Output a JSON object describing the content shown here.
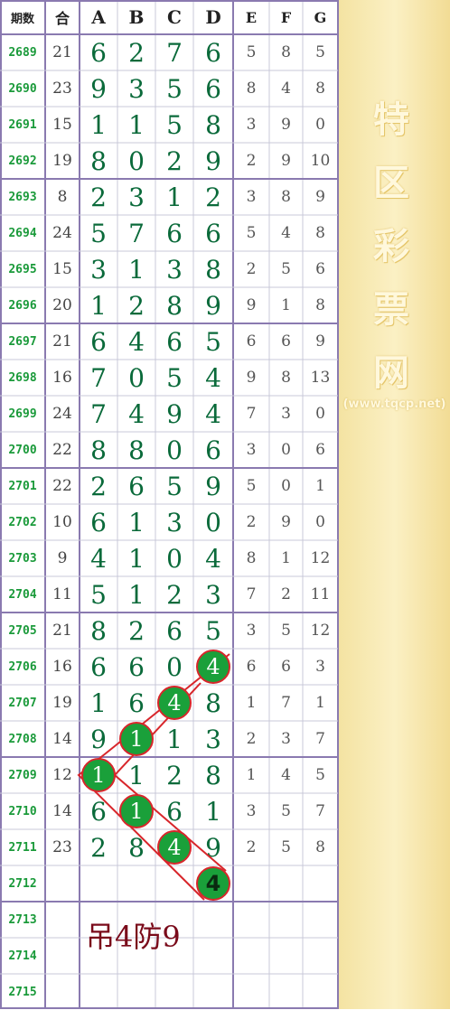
{
  "headers": [
    "期数",
    "合",
    "A",
    "B",
    "C",
    "D",
    "E",
    "F",
    "G"
  ],
  "rows": [
    {
      "issue": "2689",
      "sum": "21",
      "a": "6",
      "b": "2",
      "c": "7",
      "d": "6",
      "e": "5",
      "f": "8",
      "g": "5"
    },
    {
      "issue": "2690",
      "sum": "23",
      "a": "9",
      "b": "3",
      "c": "5",
      "d": "6",
      "e": "8",
      "f": "4",
      "g": "8"
    },
    {
      "issue": "2691",
      "sum": "15",
      "a": "1",
      "b": "1",
      "c": "5",
      "d": "8",
      "e": "3",
      "f": "9",
      "g": "0"
    },
    {
      "issue": "2692",
      "sum": "19",
      "a": "8",
      "b": "0",
      "c": "2",
      "d": "9",
      "e": "2",
      "f": "9",
      "g": "10"
    },
    {
      "issue": "2693",
      "sum": "8",
      "a": "2",
      "b": "3",
      "c": "1",
      "d": "2",
      "e": "3",
      "f": "8",
      "g": "9"
    },
    {
      "issue": "2694",
      "sum": "24",
      "a": "5",
      "b": "7",
      "c": "6",
      "d": "6",
      "e": "5",
      "f": "4",
      "g": "8"
    },
    {
      "issue": "2695",
      "sum": "15",
      "a": "3",
      "b": "1",
      "c": "3",
      "d": "8",
      "e": "2",
      "f": "5",
      "g": "6"
    },
    {
      "issue": "2696",
      "sum": "20",
      "a": "1",
      "b": "2",
      "c": "8",
      "d": "9",
      "e": "9",
      "f": "1",
      "g": "8"
    },
    {
      "issue": "2697",
      "sum": "21",
      "a": "6",
      "b": "4",
      "c": "6",
      "d": "5",
      "e": "6",
      "f": "6",
      "g": "9"
    },
    {
      "issue": "2698",
      "sum": "16",
      "a": "7",
      "b": "0",
      "c": "5",
      "d": "4",
      "e": "9",
      "f": "8",
      "g": "13"
    },
    {
      "issue": "2699",
      "sum": "24",
      "a": "7",
      "b": "4",
      "c": "9",
      "d": "4",
      "e": "7",
      "f": "3",
      "g": "0"
    },
    {
      "issue": "2700",
      "sum": "22",
      "a": "8",
      "b": "8",
      "c": "0",
      "d": "6",
      "e": "3",
      "f": "0",
      "g": "6"
    },
    {
      "issue": "2701",
      "sum": "22",
      "a": "2",
      "b": "6",
      "c": "5",
      "d": "9",
      "e": "5",
      "f": "0",
      "g": "1"
    },
    {
      "issue": "2702",
      "sum": "10",
      "a": "6",
      "b": "1",
      "c": "3",
      "d": "0",
      "e": "2",
      "f": "9",
      "g": "0"
    },
    {
      "issue": "2703",
      "sum": "9",
      "a": "4",
      "b": "1",
      "c": "0",
      "d": "4",
      "e": "8",
      "f": "1",
      "g": "12"
    },
    {
      "issue": "2704",
      "sum": "11",
      "a": "5",
      "b": "1",
      "c": "2",
      "d": "3",
      "e": "7",
      "f": "2",
      "g": "11"
    },
    {
      "issue": "2705",
      "sum": "21",
      "a": "8",
      "b": "2",
      "c": "6",
      "d": "5",
      "e": "3",
      "f": "5",
      "g": "12"
    },
    {
      "issue": "2706",
      "sum": "16",
      "a": "6",
      "b": "6",
      "c": "0",
      "d": "4",
      "e": "6",
      "f": "6",
      "g": "3"
    },
    {
      "issue": "2707",
      "sum": "19",
      "a": "1",
      "b": "6",
      "c": "4",
      "d": "8",
      "e": "1",
      "f": "7",
      "g": "1"
    },
    {
      "issue": "2708",
      "sum": "14",
      "a": "9",
      "b": "1",
      "c": "1",
      "d": "3",
      "e": "2",
      "f": "3",
      "g": "7"
    },
    {
      "issue": "2709",
      "sum": "12",
      "a": "1",
      "b": "1",
      "c": "2",
      "d": "8",
      "e": "1",
      "f": "4",
      "g": "5"
    },
    {
      "issue": "2710",
      "sum": "14",
      "a": "6",
      "b": "1",
      "c": "6",
      "d": "1",
      "e": "3",
      "f": "5",
      "g": "7"
    },
    {
      "issue": "2711",
      "sum": "23",
      "a": "2",
      "b": "8",
      "c": "4",
      "d": "9",
      "e": "2",
      "f": "5",
      "g": "8"
    },
    {
      "issue": "2712",
      "sum": "",
      "a": "",
      "b": "",
      "c": "",
      "d": "4",
      "e": "",
      "f": "",
      "g": ""
    },
    {
      "issue": "2713",
      "sum": "",
      "a": "",
      "b": "",
      "c": "",
      "d": "",
      "e": "",
      "f": "",
      "g": ""
    },
    {
      "issue": "2714",
      "sum": "",
      "a": "",
      "b": "",
      "c": "",
      "d": "",
      "e": "",
      "f": "",
      "g": ""
    },
    {
      "issue": "2715",
      "sum": "",
      "a": "",
      "b": "",
      "c": "",
      "d": "",
      "e": "",
      "f": "",
      "g": ""
    }
  ],
  "highlights": [
    {
      "row": "2706",
      "col": "d",
      "value": "4"
    },
    {
      "row": "2707",
      "col": "c",
      "value": "4"
    },
    {
      "row": "2708",
      "col": "b",
      "value": "1"
    },
    {
      "row": "2709",
      "col": "a",
      "value": "1"
    },
    {
      "row": "2710",
      "col": "b",
      "value": "1"
    },
    {
      "row": "2711",
      "col": "c",
      "value": "4"
    },
    {
      "row": "2712",
      "col": "d",
      "value": "4"
    }
  ],
  "note": "吊4防9",
  "watermark": {
    "chars": [
      "特",
      "区",
      "彩",
      "票",
      "网"
    ],
    "url": "(www.tqcp.net)"
  },
  "colors": {
    "ball": "#1aa03a",
    "ball_border": "#d8262b",
    "trend_line": "#d8262b",
    "main_digit": "#0a6a3a",
    "issue": "#1a9a3a",
    "note": "#7a0a1a",
    "grid": "#8a7ab0"
  }
}
